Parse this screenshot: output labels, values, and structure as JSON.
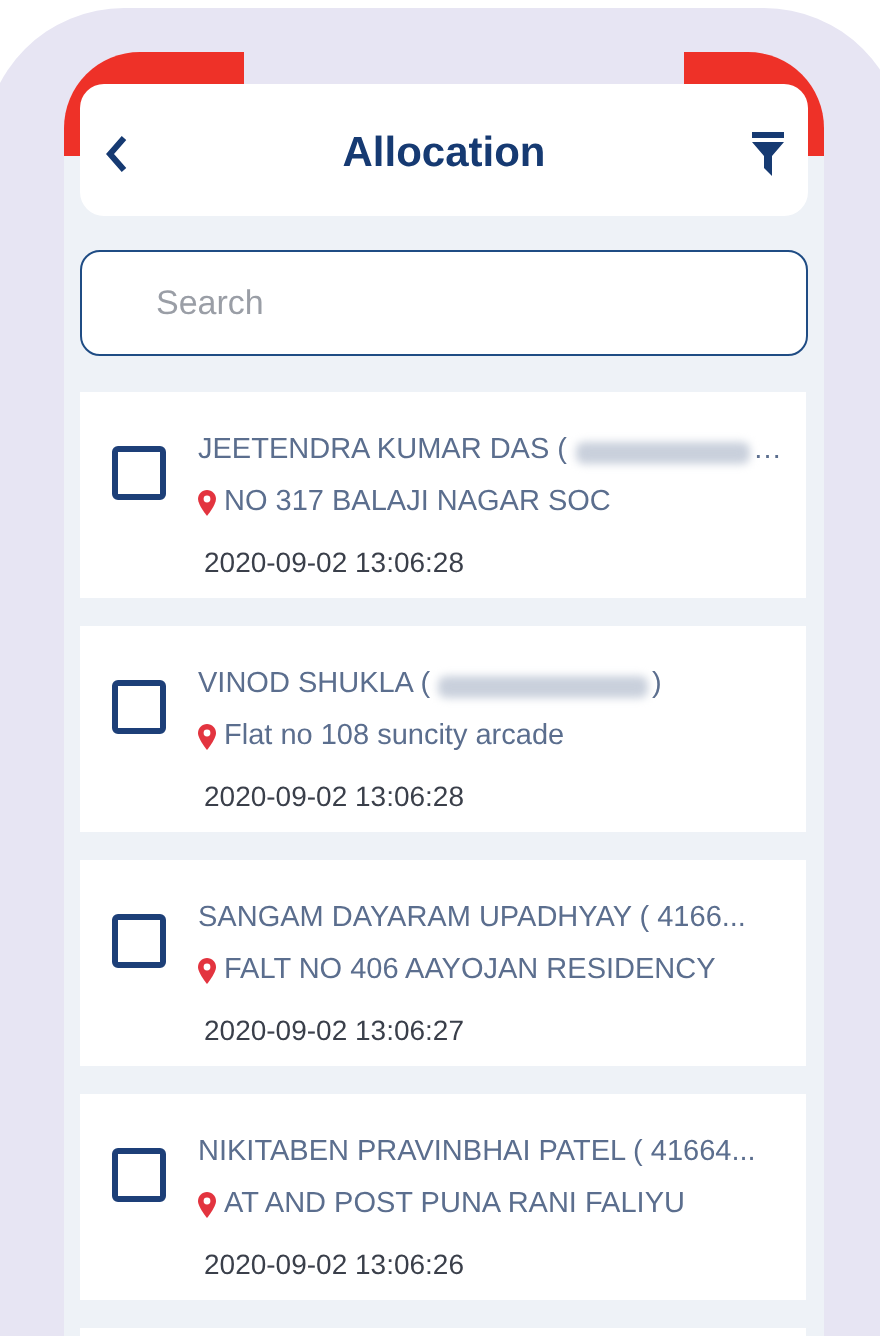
{
  "header": {
    "title": "Allocation"
  },
  "search": {
    "placeholder": "Search"
  },
  "rows": [
    {
      "title": "JEETENDRA KUMAR DAS (",
      "id_redacted": true,
      "title_end": "…",
      "address": "NO 317 BALAJI NAGAR SOC",
      "time": "2020-09-02 13:06:28",
      "checked": false
    },
    {
      "title": "VINOD SHUKLA (",
      "id_redacted": true,
      "title_end": ")",
      "address": "Flat no 108 suncity arcade",
      "time": "2020-09-02 13:06:28",
      "checked": false
    },
    {
      "title": "SANGAM DAYARAM UPADHYAY ( 4166...",
      "id_redacted": false,
      "address": "FALT NO 406 AAYOJAN RESIDENCY",
      "time": "2020-09-02 13:06:27",
      "checked": false
    },
    {
      "title": "NIKITABEN PRAVINBHAI PATEL ( 41664...",
      "id_redacted": false,
      "address": "AT AND POST PUNA RANI FALIYU",
      "time": "2020-09-02 13:06:26",
      "checked": false
    }
  ]
}
